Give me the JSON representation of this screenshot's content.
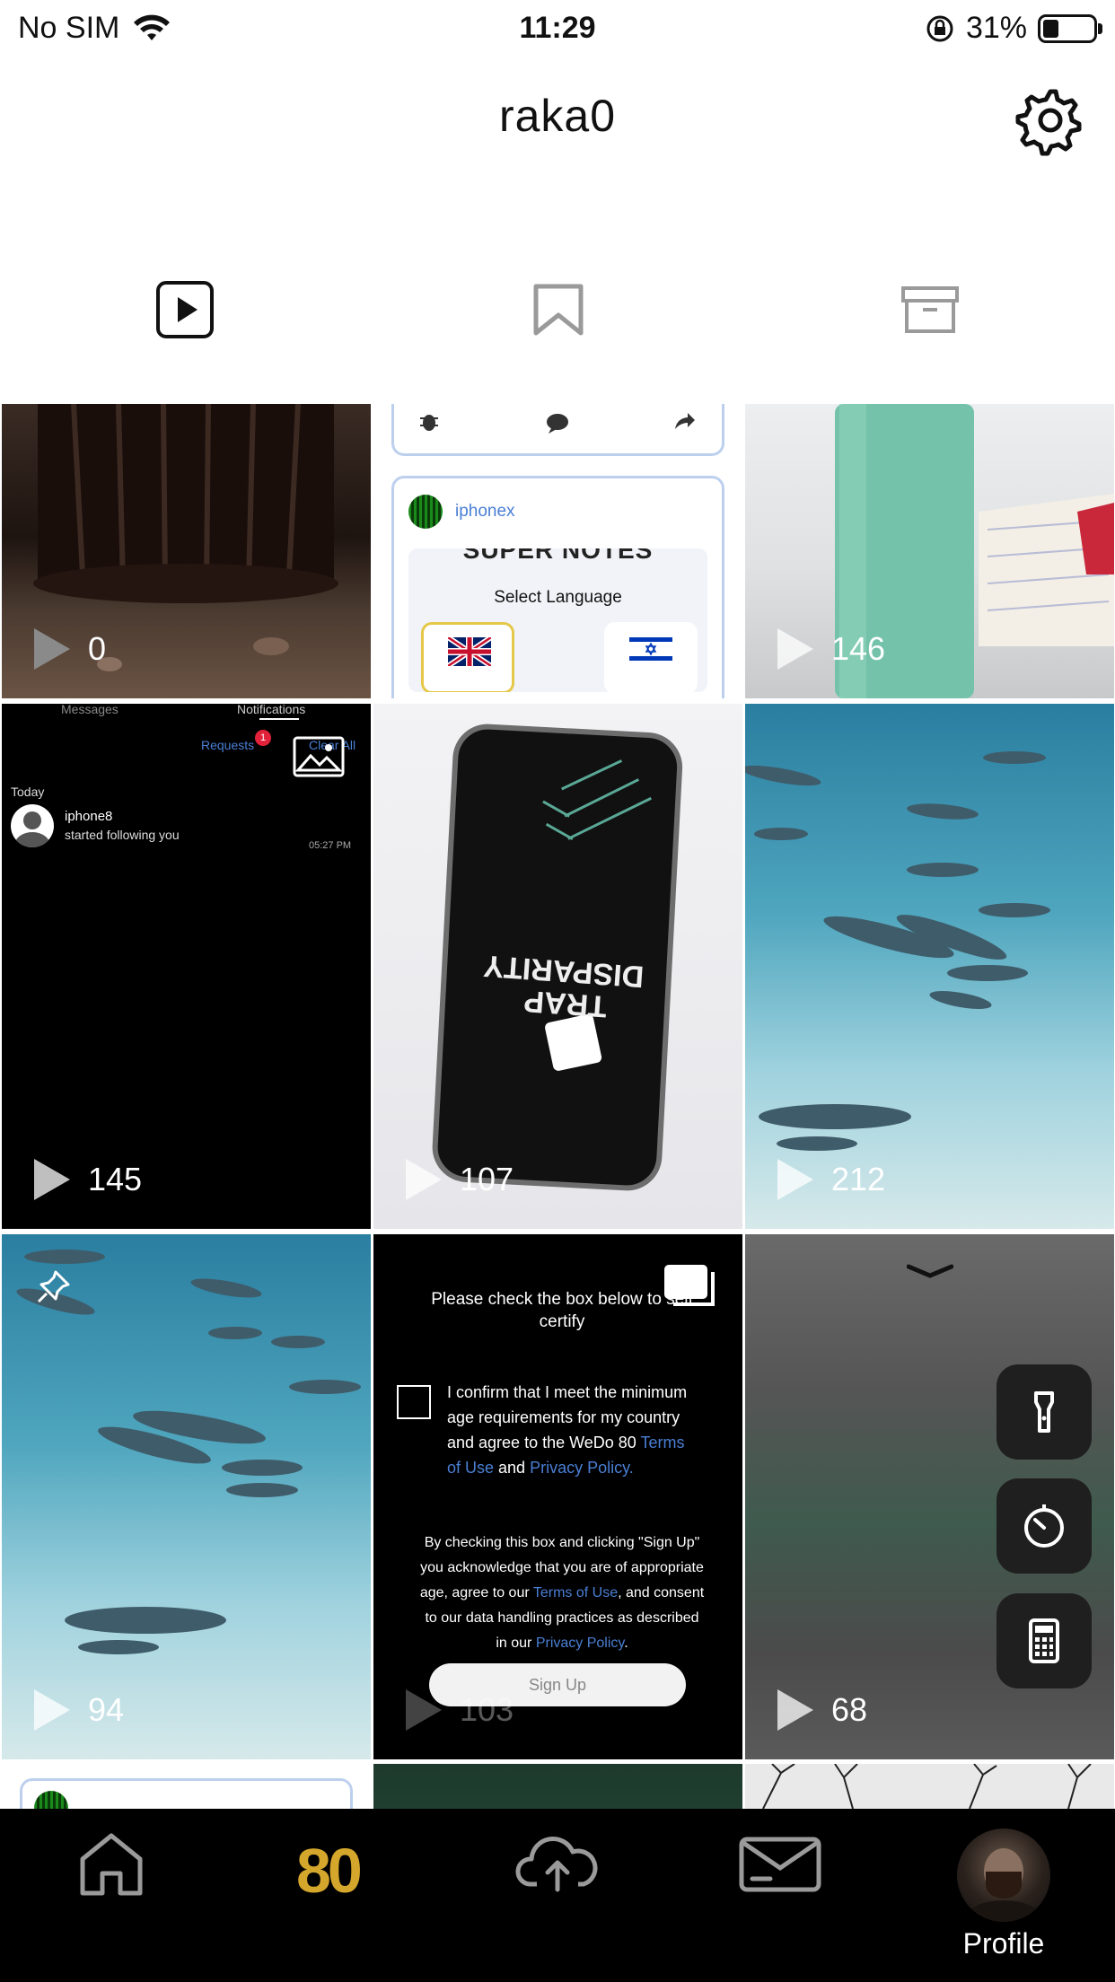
{
  "status": {
    "carrier": "No SIM",
    "time": "11:29",
    "battery": "31%",
    "battery_level": 0.31
  },
  "header": {
    "username": "raka0"
  },
  "grid": [
    {
      "count": "0"
    },
    {
      "count": "",
      "profile_name": "iphonex",
      "notes_title": "SUPER NOTES",
      "select_language": "Select Language"
    },
    {
      "count": "146"
    },
    {
      "count": "145",
      "tab_messages": "Messages",
      "tab_notifications": "Notifications",
      "requests": "Requests",
      "requests_badge": "1",
      "clear_all": "Clear All",
      "today": "Today",
      "notif_user": "iphone8",
      "notif_text": "started following you",
      "notif_time": "05:27 PM"
    },
    {
      "count": "107",
      "phone_text_1": "DISPARITY",
      "phone_text_2": "TRAP"
    },
    {
      "count": "212"
    },
    {
      "count": "94"
    },
    {
      "count": "103",
      "check_title": "Please check the box below to self certify",
      "confirm_a": "I confirm that I meet the minimum age requirements for my country and agree to the WeDo 80 ",
      "terms_of_use": "Terms of Use",
      "confirm_b": " and ",
      "privacy_policy": "Privacy Policy.",
      "by_checking_a": "By checking this box and clicking \"Sign Up\" you acknowledge that you are of appropriate age, agree to our ",
      "by_checking_b": ", and consent to our data handling practices as described in our ",
      "privacy_policy_2": "Privacy Policy",
      "period": ".",
      "sign_up": "Sign Up"
    },
    {
      "count": "68"
    }
  ],
  "nav": {
    "logo": "80",
    "profile_label": "Profile"
  },
  "colors": {
    "brand_gold": "#d4a72c",
    "link_blue": "#4a7fd4"
  }
}
